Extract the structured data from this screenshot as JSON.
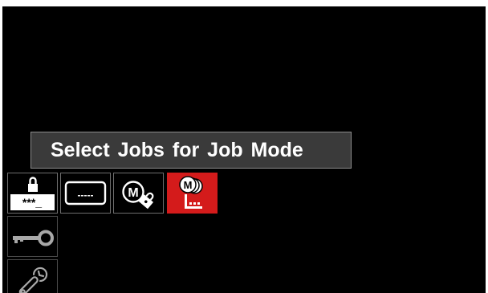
{
  "tooltip": {
    "text": "Select Jobs for Job Mode"
  },
  "toolbar": {
    "items": [
      {
        "icon": "lock-password-icon",
        "label": "***_",
        "active": false
      },
      {
        "icon": "display-icon",
        "label": "-----",
        "active": false
      },
      {
        "icon": "memory-lock-icon",
        "label": "M",
        "active": false
      },
      {
        "icon": "job-mode-icon",
        "label": "M",
        "active": true
      }
    ]
  },
  "sidebar": {
    "items": [
      {
        "icon": "key-icon"
      },
      {
        "icon": "wrench-icon"
      }
    ]
  },
  "colors": {
    "background": "#000000",
    "active": "#d41b1b",
    "tooltip_bg": "#3a3a3a"
  }
}
